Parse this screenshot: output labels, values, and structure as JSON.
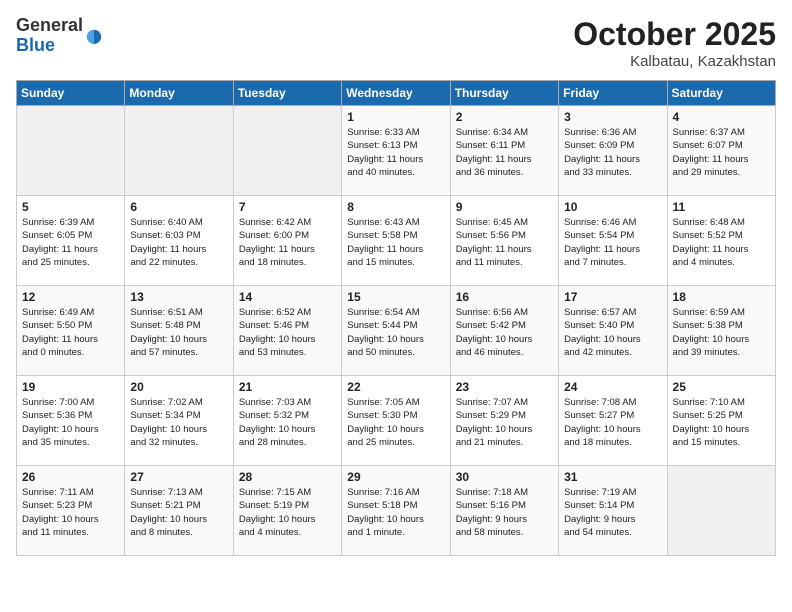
{
  "header": {
    "logo": {
      "general": "General",
      "blue": "Blue"
    },
    "title": "October 2025",
    "location": "Kalbatau, Kazakhstan"
  },
  "calendar": {
    "days_of_week": [
      "Sunday",
      "Monday",
      "Tuesday",
      "Wednesday",
      "Thursday",
      "Friday",
      "Saturday"
    ],
    "weeks": [
      [
        {
          "day": "",
          "content": ""
        },
        {
          "day": "",
          "content": ""
        },
        {
          "day": "",
          "content": ""
        },
        {
          "day": "1",
          "content": "Sunrise: 6:33 AM\nSunset: 6:13 PM\nDaylight: 11 hours\nand 40 minutes."
        },
        {
          "day": "2",
          "content": "Sunrise: 6:34 AM\nSunset: 6:11 PM\nDaylight: 11 hours\nand 36 minutes."
        },
        {
          "day": "3",
          "content": "Sunrise: 6:36 AM\nSunset: 6:09 PM\nDaylight: 11 hours\nand 33 minutes."
        },
        {
          "day": "4",
          "content": "Sunrise: 6:37 AM\nSunset: 6:07 PM\nDaylight: 11 hours\nand 29 minutes."
        }
      ],
      [
        {
          "day": "5",
          "content": "Sunrise: 6:39 AM\nSunset: 6:05 PM\nDaylight: 11 hours\nand 25 minutes."
        },
        {
          "day": "6",
          "content": "Sunrise: 6:40 AM\nSunset: 6:03 PM\nDaylight: 11 hours\nand 22 minutes."
        },
        {
          "day": "7",
          "content": "Sunrise: 6:42 AM\nSunset: 6:00 PM\nDaylight: 11 hours\nand 18 minutes."
        },
        {
          "day": "8",
          "content": "Sunrise: 6:43 AM\nSunset: 5:58 PM\nDaylight: 11 hours\nand 15 minutes."
        },
        {
          "day": "9",
          "content": "Sunrise: 6:45 AM\nSunset: 5:56 PM\nDaylight: 11 hours\nand 11 minutes."
        },
        {
          "day": "10",
          "content": "Sunrise: 6:46 AM\nSunset: 5:54 PM\nDaylight: 11 hours\nand 7 minutes."
        },
        {
          "day": "11",
          "content": "Sunrise: 6:48 AM\nSunset: 5:52 PM\nDaylight: 11 hours\nand 4 minutes."
        }
      ],
      [
        {
          "day": "12",
          "content": "Sunrise: 6:49 AM\nSunset: 5:50 PM\nDaylight: 11 hours\nand 0 minutes."
        },
        {
          "day": "13",
          "content": "Sunrise: 6:51 AM\nSunset: 5:48 PM\nDaylight: 10 hours\nand 57 minutes."
        },
        {
          "day": "14",
          "content": "Sunrise: 6:52 AM\nSunset: 5:46 PM\nDaylight: 10 hours\nand 53 minutes."
        },
        {
          "day": "15",
          "content": "Sunrise: 6:54 AM\nSunset: 5:44 PM\nDaylight: 10 hours\nand 50 minutes."
        },
        {
          "day": "16",
          "content": "Sunrise: 6:56 AM\nSunset: 5:42 PM\nDaylight: 10 hours\nand 46 minutes."
        },
        {
          "day": "17",
          "content": "Sunrise: 6:57 AM\nSunset: 5:40 PM\nDaylight: 10 hours\nand 42 minutes."
        },
        {
          "day": "18",
          "content": "Sunrise: 6:59 AM\nSunset: 5:38 PM\nDaylight: 10 hours\nand 39 minutes."
        }
      ],
      [
        {
          "day": "19",
          "content": "Sunrise: 7:00 AM\nSunset: 5:36 PM\nDaylight: 10 hours\nand 35 minutes."
        },
        {
          "day": "20",
          "content": "Sunrise: 7:02 AM\nSunset: 5:34 PM\nDaylight: 10 hours\nand 32 minutes."
        },
        {
          "day": "21",
          "content": "Sunrise: 7:03 AM\nSunset: 5:32 PM\nDaylight: 10 hours\nand 28 minutes."
        },
        {
          "day": "22",
          "content": "Sunrise: 7:05 AM\nSunset: 5:30 PM\nDaylight: 10 hours\nand 25 minutes."
        },
        {
          "day": "23",
          "content": "Sunrise: 7:07 AM\nSunset: 5:29 PM\nDaylight: 10 hours\nand 21 minutes."
        },
        {
          "day": "24",
          "content": "Sunrise: 7:08 AM\nSunset: 5:27 PM\nDaylight: 10 hours\nand 18 minutes."
        },
        {
          "day": "25",
          "content": "Sunrise: 7:10 AM\nSunset: 5:25 PM\nDaylight: 10 hours\nand 15 minutes."
        }
      ],
      [
        {
          "day": "26",
          "content": "Sunrise: 7:11 AM\nSunset: 5:23 PM\nDaylight: 10 hours\nand 11 minutes."
        },
        {
          "day": "27",
          "content": "Sunrise: 7:13 AM\nSunset: 5:21 PM\nDaylight: 10 hours\nand 8 minutes."
        },
        {
          "day": "28",
          "content": "Sunrise: 7:15 AM\nSunset: 5:19 PM\nDaylight: 10 hours\nand 4 minutes."
        },
        {
          "day": "29",
          "content": "Sunrise: 7:16 AM\nSunset: 5:18 PM\nDaylight: 10 hours\nand 1 minute."
        },
        {
          "day": "30",
          "content": "Sunrise: 7:18 AM\nSunset: 5:16 PM\nDaylight: 9 hours\nand 58 minutes."
        },
        {
          "day": "31",
          "content": "Sunrise: 7:19 AM\nSunset: 5:14 PM\nDaylight: 9 hours\nand 54 minutes."
        },
        {
          "day": "",
          "content": ""
        }
      ]
    ]
  }
}
